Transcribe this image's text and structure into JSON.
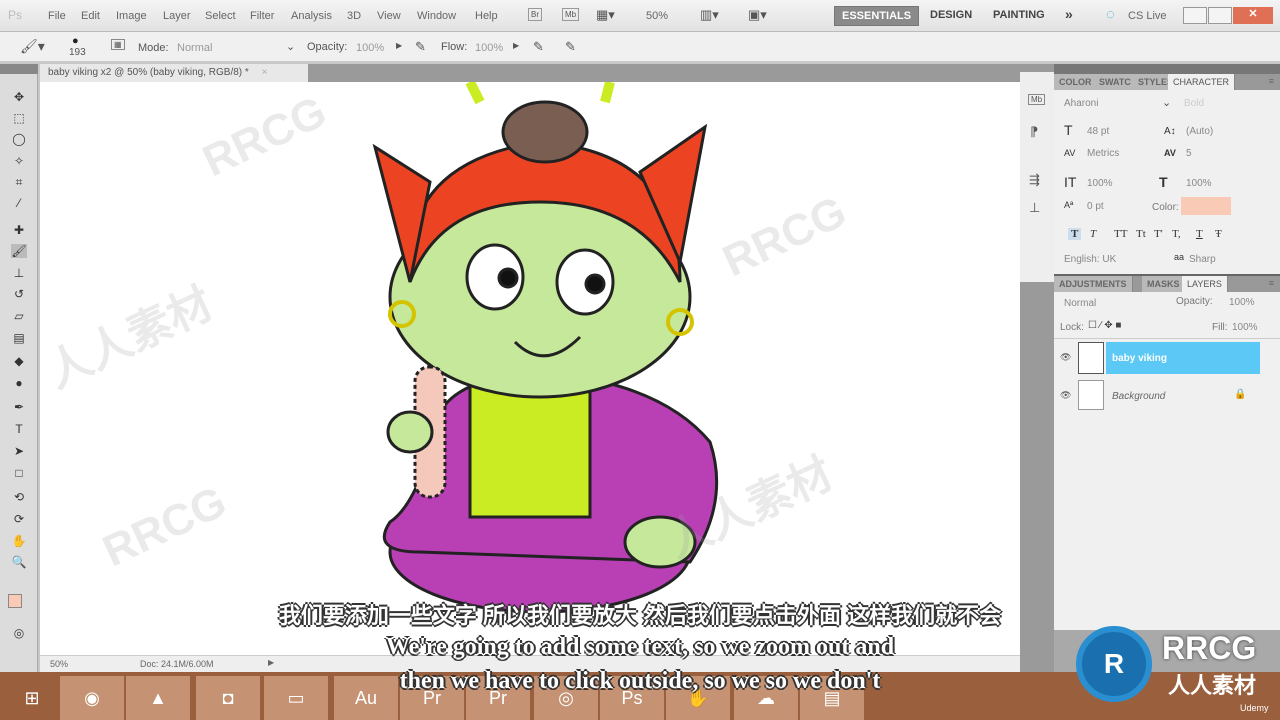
{
  "menu": [
    "File",
    "Edit",
    "Image",
    "Layer",
    "Select",
    "Filter",
    "Analysis",
    "3D",
    "View",
    "Window",
    "Help"
  ],
  "appbar": {
    "zoom": "50%",
    "workspaces": [
      "ESSENTIALS",
      "DESIGN",
      "PAINTING"
    ],
    "more": "»",
    "cslive": "CS Live"
  },
  "options": {
    "brush_size": "193",
    "mode_label": "Mode:",
    "mode": "Normal",
    "opacity_label": "Opacity:",
    "opacity": "100%",
    "flow_label": "Flow:",
    "flow": "100%"
  },
  "document": {
    "tab": "baby viking x2 @ 50% (baby viking, RGB/8) *",
    "zoom": "50%",
    "doc_size": "Doc: 24.1M/6.00M"
  },
  "character_panel": {
    "tabs": [
      "COLOR",
      "SWATC",
      "STYLES",
      "CHARACTER"
    ],
    "font": "Aharoni",
    "style": "Bold",
    "size": "48 pt",
    "leading": "(Auto)",
    "kerning": "Metrics",
    "tracking": "5",
    "vscale": "100%",
    "hscale": "100%",
    "baseline": "0 pt",
    "color_label": "Color:",
    "color": "#f9cbb6",
    "styles": [
      "T",
      "T",
      "TT",
      "Tt",
      "T'",
      "T,",
      "T",
      "Ŧ"
    ],
    "language": "English: UK",
    "aa_label": "aa",
    "antialias": "Sharp"
  },
  "layers_panel": {
    "tabs": [
      "ADJUSTMENTS",
      "MASKS",
      "LAYERS"
    ],
    "blend": "Normal",
    "opacity_label": "Opacity:",
    "opacity": "100%",
    "lock_label": "Lock:",
    "fill_label": "Fill:",
    "fill": "100%",
    "layers": [
      {
        "name": "baby viking",
        "selected": true
      },
      {
        "name": "Background",
        "selected": false
      }
    ]
  },
  "subtitles": {
    "zh": "我们要添加一些文字 所以我们要放大 然后我们要点击外面 这样我们就不会",
    "en1": "We're going to add some text, so we zoom out and",
    "en2": "then we have to click outside, so we so we don't"
  },
  "watermark": {
    "brand": "RRCG",
    "cn": "人人素材",
    "udemy": "Udemy"
  },
  "colors": {
    "accent": "#5bc8f5",
    "taskbar": "#9a5f3c"
  }
}
